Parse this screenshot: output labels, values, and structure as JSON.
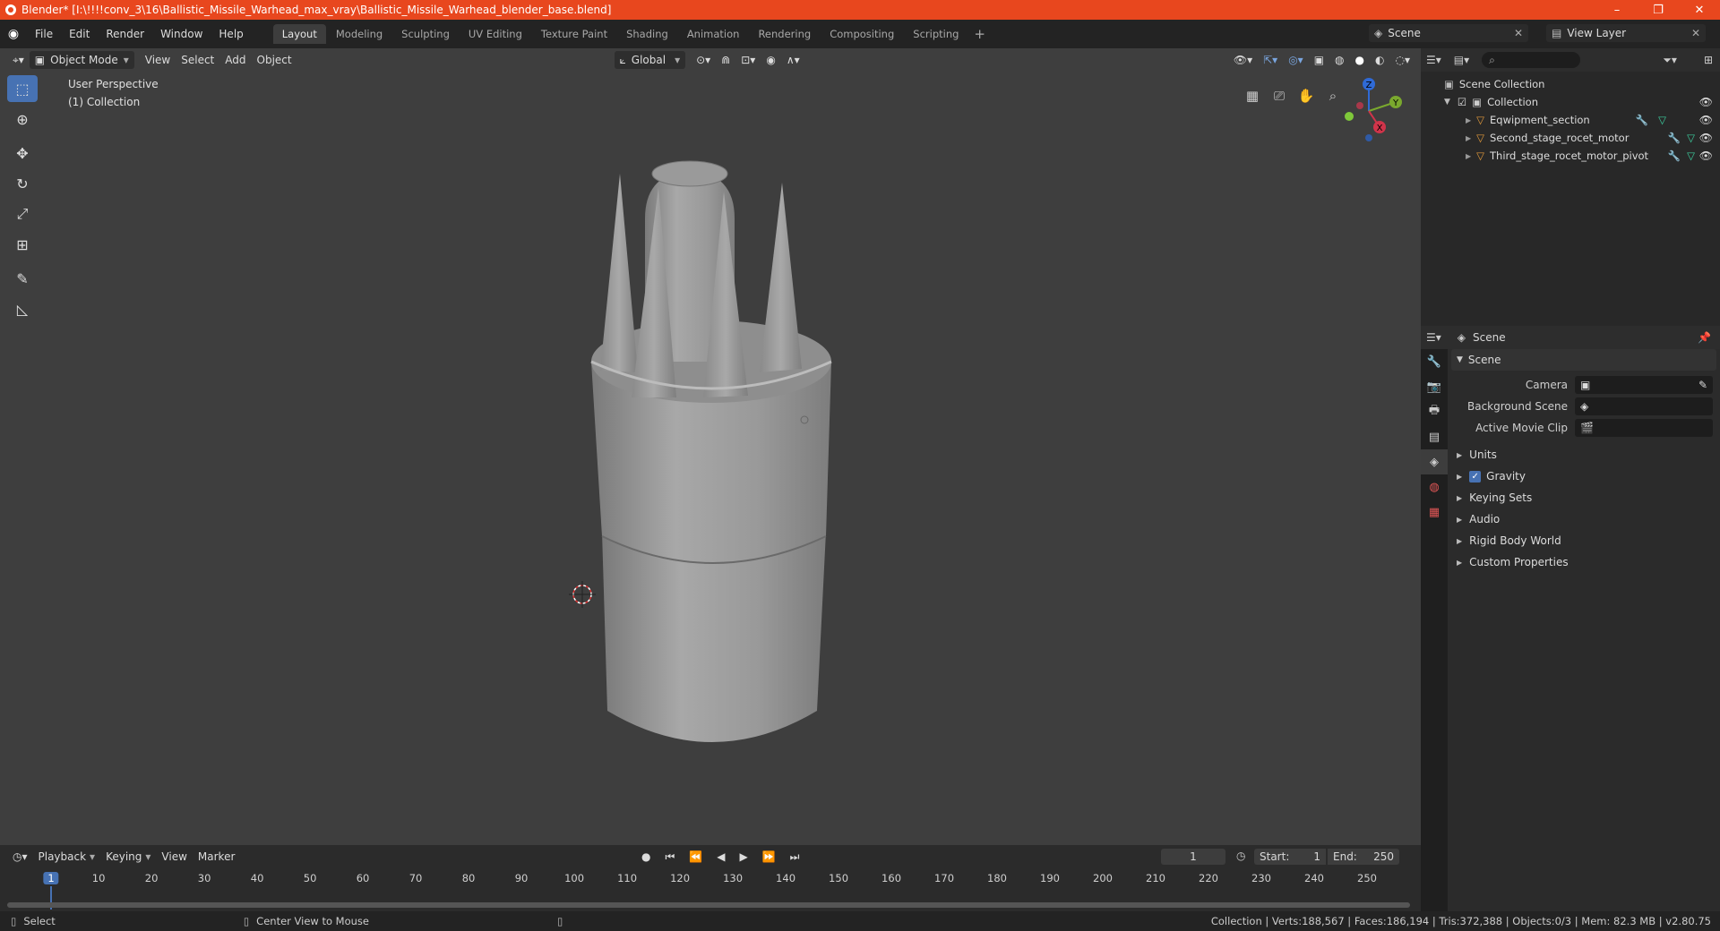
{
  "title": "Blender* [I:\\!!!!conv_3\\16\\Ballistic_Missile_Warhead_max_vray\\Ballistic_Missile_Warhead_blender_base.blend]",
  "window_buttons": [
    "–",
    "❐",
    "✕"
  ],
  "menu": [
    "File",
    "Edit",
    "Render",
    "Window",
    "Help"
  ],
  "workspaces": [
    "Layout",
    "Modeling",
    "Sculpting",
    "UV Editing",
    "Texture Paint",
    "Shading",
    "Animation",
    "Rendering",
    "Compositing",
    "Scripting"
  ],
  "scene_name": "Scene",
  "view_layer": "View Layer",
  "viewport": {
    "mode": "Object Mode",
    "menus": [
      "View",
      "Select",
      "Add",
      "Object"
    ],
    "orientation": "Global",
    "info_line1": "User Perspective",
    "info_line2": "(1) Collection",
    "gizmo_axes": [
      "X",
      "Y",
      "Z"
    ]
  },
  "outliner": {
    "root": "Scene Collection",
    "collection": "Collection",
    "objects": [
      "Eqwipment_section",
      "Second_stage_rocet_motor",
      "Third_stage_rocet_motor_pivot"
    ]
  },
  "properties": {
    "header": "Scene",
    "panel": "Scene",
    "camera_label": "Camera",
    "background_scene_label": "Background Scene",
    "active_movie_clip_label": "Active Movie Clip",
    "sections": [
      "Units",
      "Gravity",
      "Keying Sets",
      "Audio",
      "Rigid Body World",
      "Custom Properties"
    ]
  },
  "timeline": {
    "menus": [
      "Playback",
      "Keying",
      "View",
      "Marker"
    ],
    "current_frame": "1",
    "start_label": "Start:",
    "start": "1",
    "end_label": "End:",
    "end": "250",
    "ticks": [
      "1",
      "10",
      "20",
      "30",
      "40",
      "50",
      "60",
      "70",
      "80",
      "90",
      "100",
      "110",
      "120",
      "130",
      "140",
      "150",
      "160",
      "170",
      "180",
      "190",
      "200",
      "210",
      "220",
      "230",
      "240",
      "250"
    ]
  },
  "status": {
    "left": "Select",
    "middle": "Center View to Mouse",
    "right": "Collection | Verts:188,567 | Faces:186,194 | Tris:372,388 | Objects:0/3 | Mem: 82.3 MB | v2.80.75"
  },
  "colors": {
    "titlebar": "#e8471e",
    "accent": "#4772b3",
    "viewport": "#3e3e3e"
  }
}
